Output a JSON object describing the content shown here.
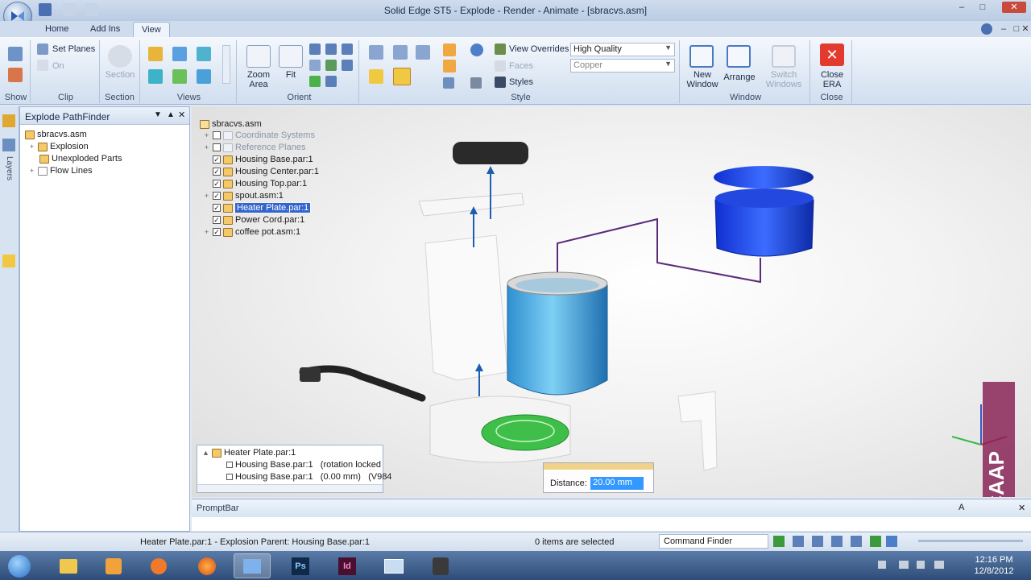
{
  "window": {
    "title": "Solid Edge ST5 - Explode - Render - Animate - [sbracvs.asm]"
  },
  "tabs": [
    "Home",
    "Add Ins",
    "View"
  ],
  "ribbon": {
    "show": {
      "label": "Show"
    },
    "clip": {
      "set_planes": "Set Planes",
      "on": "On",
      "label": "Clip"
    },
    "section": {
      "button": "Section",
      "label": "Section"
    },
    "views": {
      "label": "Views"
    },
    "orient": {
      "zoom_area": "Zoom\nArea",
      "fit": "Fit",
      "label": "Orient"
    },
    "style": {
      "view_overrides": "View Overrides",
      "quality": "High Quality",
      "faces": "Faces",
      "material": "Copper",
      "styles": "Styles",
      "label": "Style"
    },
    "window": {
      "new_window": "New\nWindow",
      "arrange": "Arrange",
      "switch_windows": "Switch\nWindows",
      "label": "Window"
    },
    "close": {
      "close_era": "Close\nERA",
      "label": "Close"
    }
  },
  "leftstrip": {
    "layers": "Layers"
  },
  "pathfinder": {
    "title": "Explode PathFinder",
    "tree": [
      "sbracvs.asm",
      "Explosion",
      "Unexploded Parts",
      "Flow Lines"
    ]
  },
  "viewport_tree": {
    "root": "sbracvs.asm",
    "items": [
      {
        "label": "Coordinate Systems",
        "checked": false,
        "dim": true,
        "type": "coord"
      },
      {
        "label": "Reference Planes",
        "checked": false,
        "dim": true,
        "type": "plane"
      },
      {
        "label": "Housing Base.par:1",
        "checked": true,
        "type": "part"
      },
      {
        "label": "Housing Center.par:1",
        "checked": true,
        "type": "part"
      },
      {
        "label": "Housing Top.par:1",
        "checked": true,
        "type": "part"
      },
      {
        "label": "spout.asm:1",
        "checked": true,
        "type": "asm"
      },
      {
        "label": "Heater Plate.par:1",
        "checked": true,
        "type": "part",
        "selected": true
      },
      {
        "label": "Power Cord.par:1",
        "checked": true,
        "type": "part"
      },
      {
        "label": "coffee pot.asm:1",
        "checked": true,
        "type": "asm"
      }
    ]
  },
  "lower_panel": {
    "header": "Heater Plate.par:1",
    "rows": [
      "Housing Base.par:1   (rotation locked",
      "Housing Base.par:1   (0.00 mm)   (V984"
    ]
  },
  "distance": {
    "label": "Distance:",
    "value": "20.00 mm"
  },
  "promptbar": {
    "title": "PromptBar"
  },
  "status": {
    "message": "Heater Plate.par:1 - Explosion Parent: Housing Base.par:1",
    "selection": "0 items are selected",
    "command_finder": "Command Finder"
  },
  "watermark": "CAAP",
  "clock": {
    "time": "12:16 PM",
    "date": "12/8/2012"
  },
  "colors": {
    "accent": "#2f6fd0",
    "ribbon": "#dbe6f3",
    "selection": "#3366cc",
    "flowline": "#5a2a7a"
  }
}
